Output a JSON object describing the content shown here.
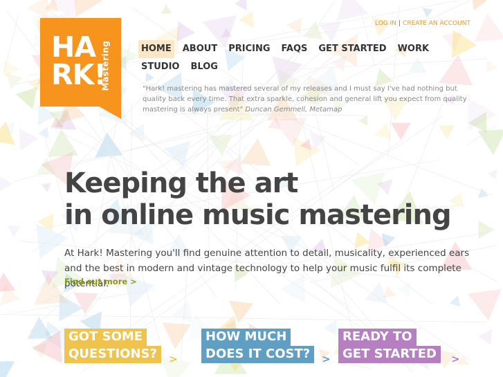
{
  "logo": {
    "letters_line1": "HA",
    "letters_line2": "RK!",
    "side_text": "Mastering",
    "color": "#f7941d"
  },
  "account": {
    "login": "LOG IN",
    "separator": "|",
    "create": "CREATE AN ACCOUNT"
  },
  "nav": {
    "items": [
      {
        "label": "HOME",
        "active": true
      },
      {
        "label": "ABOUT"
      },
      {
        "label": "PRICING"
      },
      {
        "label": "FAQS"
      },
      {
        "label": "GET STARTED"
      },
      {
        "label": "WORK"
      },
      {
        "label": "STUDIO"
      },
      {
        "label": "BLOG"
      }
    ]
  },
  "quote": {
    "text": "\"Hark! mastering has mastered several of my releases and I must say I've had nothing but quality back every time. That extra sparkle, cohesion and general lift you expect from quality mastering is always present\"",
    "attribution": "Duncan Gemmell, Metamap"
  },
  "hero": {
    "headline_line1": "Keeping the art",
    "headline_line2": "in online music mastering",
    "intro": "At Hark! Mastering you'll find genuine attention to detail, musicality, experienced ears and the best in modern and vintage technology to help your music fulfil its complete potential.",
    "find_out_more": "Find out more >"
  },
  "ctas": [
    {
      "line1": "GOT SOME",
      "line2": "QUESTIONS?",
      "arrow": ">",
      "color": "#f0c44c"
    },
    {
      "line1": "HOW MUCH",
      "line2": "DOES IT COST?",
      "arrow": ">",
      "color": "#5f9fc4"
    },
    {
      "line1": "READY TO",
      "line2": "GET STARTED",
      "arrow": ">",
      "color": "#b67fc1"
    }
  ],
  "colors": {
    "accent": "#f7941d",
    "link_green": "#8a9a00",
    "nav_active_bg": "#fbe6c6"
  }
}
